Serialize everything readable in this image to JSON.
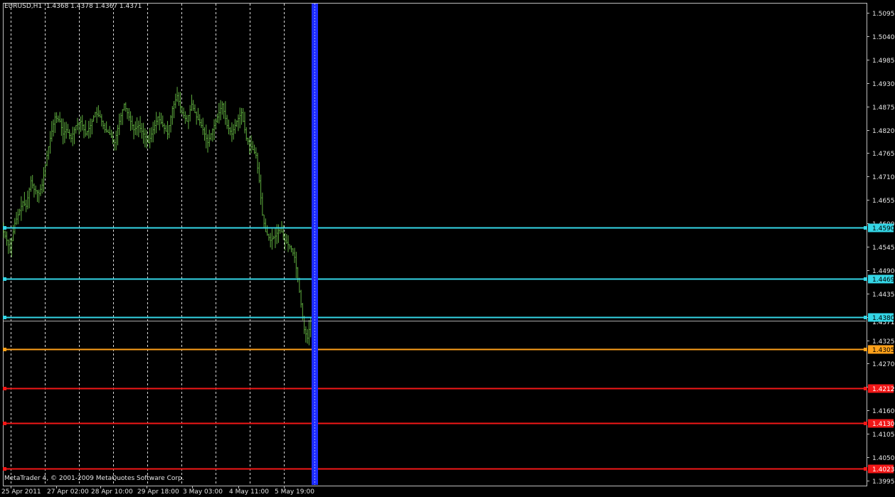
{
  "window": {
    "symbol_info": "EURUSD,H1  1.4368 1.4378 1.4367 1.4371",
    "copyright": "MetaTrader 4, © 2001-2009 MetaQuotes Software Corp."
  },
  "colors": {
    "background": "#000000",
    "frame": "#bdbdbd",
    "grid": "#d8d8d8",
    "candles": "#5fae3f",
    "axis_text": "#e6e6e6",
    "level_cyan": "#34d6e6",
    "level_orange": "#ffa11a",
    "level_red": "#f21717",
    "current_bar_blue": "#1e2dff",
    "bid_line": "#b0b0b0"
  },
  "chart_data": {
    "type": "ohlc",
    "symbol": "EURUSD",
    "timeframe": "H1",
    "last_bar": {
      "open": 1.4368,
      "high": 1.4378,
      "low": 1.4367,
      "close": 1.4371
    },
    "ylim": [
      1.3972,
      1.5115
    ],
    "y_ticks": [
      "1.5095",
      "1.5040",
      "1.4985",
      "1.4930",
      "1.4875",
      "1.4820",
      "1.4765",
      "1.4710",
      "1.4655",
      "1.4600",
      "1.4545",
      "1.4490",
      "1.4435",
      "1.4380",
      "1.4325",
      "1.4270",
      "1.4215",
      "1.4160",
      "1.4105",
      "1.4050",
      "1.3995"
    ],
    "x_ticks": [
      "25 Apr 2011",
      "27 Apr 02:00",
      "28 Apr 10:00",
      "29 Apr 18:00",
      "3 May 03:00",
      "4 May 11:00",
      "5 May 19:00"
    ],
    "grid": true,
    "bid_price": "1.4371",
    "levels": [
      {
        "price": 1.459,
        "label": "1.4590",
        "color": "cyan"
      },
      {
        "price": 1.4469,
        "label": "1.4469",
        "color": "cyan"
      },
      {
        "price": 1.438,
        "label": "1.4380",
        "color": "cyan"
      },
      {
        "price": 1.4305,
        "label": "1.4305",
        "color": "orange"
      },
      {
        "price": 1.4212,
        "label": "1.4212",
        "color": "red"
      },
      {
        "price": 1.413,
        "label": "1.4130",
        "color": "red"
      },
      {
        "price": 1.4023,
        "label": "1.4023",
        "color": "red"
      }
    ],
    "price_path": [
      [
        0,
        1.459
      ],
      [
        3,
        1.456
      ],
      [
        5,
        1.454
      ],
      [
        8,
        1.46
      ],
      [
        10,
        1.462
      ],
      [
        13,
        1.465
      ],
      [
        15,
        1.464
      ],
      [
        18,
        1.47
      ],
      [
        20,
        1.468
      ],
      [
        23,
        1.467
      ],
      [
        25,
        1.469
      ],
      [
        28,
        1.476
      ],
      [
        30,
        1.48
      ],
      [
        33,
        1.485
      ],
      [
        36,
        1.484
      ],
      [
        38,
        1.481
      ],
      [
        40,
        1.482
      ],
      [
        43,
        1.48
      ],
      [
        46,
        1.483
      ],
      [
        49,
        1.484
      ],
      [
        52,
        1.481
      ],
      [
        55,
        1.483
      ],
      [
        58,
        1.486
      ],
      [
        61,
        1.485
      ],
      [
        64,
        1.482
      ],
      [
        67,
        1.481
      ],
      [
        70,
        1.479
      ],
      [
        73,
        1.484
      ],
      [
        76,
        1.488
      ],
      [
        79,
        1.485
      ],
      [
        82,
        1.482
      ],
      [
        85,
        1.483
      ],
      [
        88,
        1.481
      ],
      [
        91,
        1.479
      ],
      [
        94,
        1.482
      ],
      [
        97,
        1.485
      ],
      [
        100,
        1.483
      ],
      [
        103,
        1.481
      ],
      [
        106,
        1.487
      ],
      [
        109,
        1.49
      ],
      [
        112,
        1.486
      ],
      [
        115,
        1.484
      ],
      [
        118,
        1.488
      ],
      [
        121,
        1.485
      ],
      [
        124,
        1.483
      ],
      [
        128,
        1.479
      ],
      [
        131,
        1.482
      ],
      [
        134,
        1.485
      ],
      [
        137,
        1.488
      ],
      [
        140,
        1.483
      ],
      [
        143,
        1.481
      ],
      [
        146,
        1.484
      ],
      [
        149,
        1.486
      ],
      [
        152,
        1.48
      ],
      [
        155,
        1.478
      ],
      [
        158,
        1.476
      ],
      [
        160,
        1.47
      ],
      [
        162,
        1.462
      ],
      [
        164,
        1.458
      ],
      [
        167,
        1.456
      ],
      [
        170,
        1.457
      ],
      [
        173,
        1.459
      ],
      [
        176,
        1.456
      ],
      [
        178,
        1.455
      ],
      [
        180,
        1.454
      ],
      [
        182,
        1.452
      ],
      [
        184,
        1.447
      ],
      [
        186,
        1.441
      ],
      [
        188,
        1.435
      ],
      [
        190,
        1.433
      ],
      [
        192,
        1.4371
      ]
    ]
  }
}
